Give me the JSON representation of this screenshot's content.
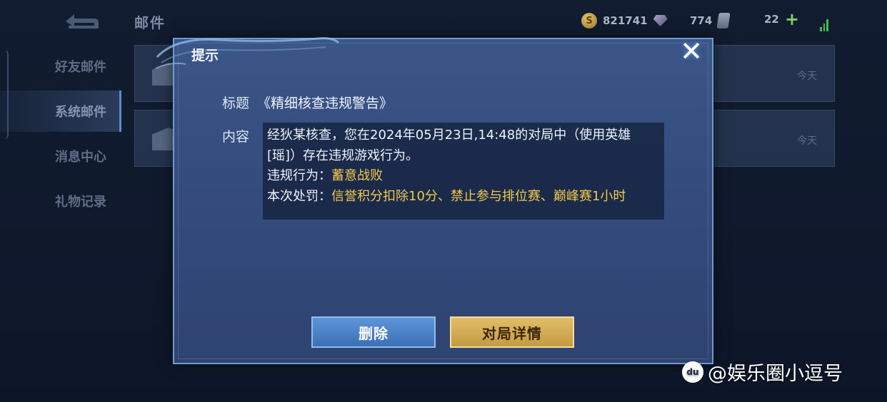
{
  "header": {
    "title": "邮件",
    "coins": "821741",
    "gems": "774",
    "tickets": "22"
  },
  "sidebar": {
    "items": [
      {
        "label": "好友邮件"
      },
      {
        "label": "系统邮件"
      },
      {
        "label": "消息中心"
      },
      {
        "label": "礼物记录"
      }
    ]
  },
  "mail_list": [
    {
      "date": "今天"
    },
    {
      "date": "今天"
    }
  ],
  "dialog": {
    "title": "提示",
    "subject_label": "标题",
    "subject": "《精细核查违规警告》",
    "content_label": "内容",
    "content_line1": "经狄某核查，您在2024年05月23日,14:48的对局中（使用英雄[瑶]）存在违规游戏行为。",
    "violation_label": "违规行为：",
    "violation_value": "蓄意战败",
    "penalty_label": "本次处罚：",
    "penalty_value": "信誉积分扣除10分、禁止参与排位赛、巅峰赛1小时",
    "delete_button": "删除",
    "detail_button": "对局详情"
  },
  "watermark": {
    "text": "@娱乐圈小逗号"
  },
  "colors": {
    "highlight": "#f2c94c",
    "delete_button": "#4a82c8",
    "detail_button": "#d4ad55"
  }
}
